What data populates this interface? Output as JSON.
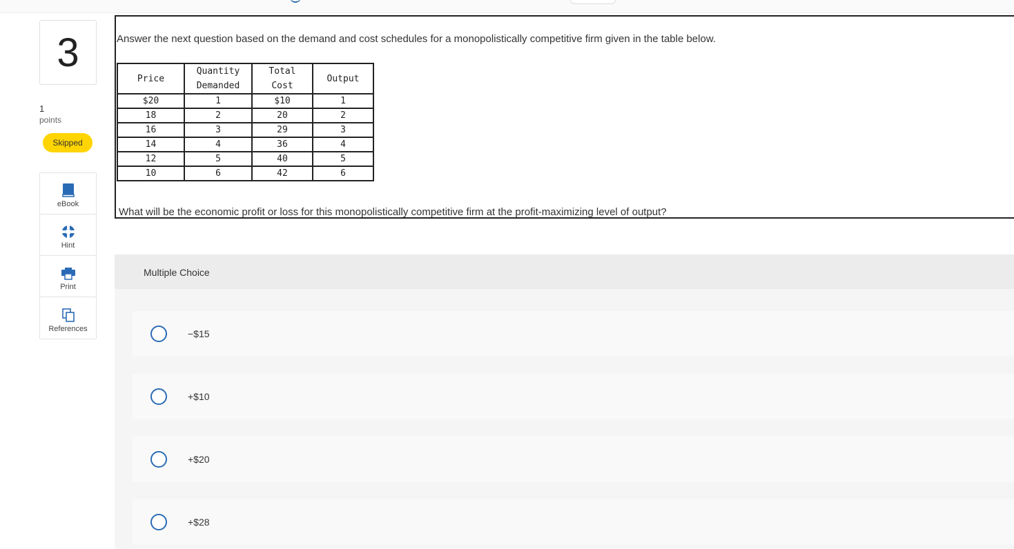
{
  "question": {
    "number": "3",
    "points_value": "1",
    "points_label": "points",
    "status_badge": "Skipped",
    "intro": "Answer the next question based on the demand and cost schedules for a monopolistically competitive firm given in the table below.",
    "prompt": "What will be the economic profit or loss for this monopolistically competitive firm at the profit-maximizing level of output?"
  },
  "tools": [
    {
      "label": "eBook",
      "icon": "book-icon"
    },
    {
      "label": "Hint",
      "icon": "lifebuoy-icon"
    },
    {
      "label": "Print",
      "icon": "printer-icon"
    },
    {
      "label": "References",
      "icon": "copy-icon"
    }
  ],
  "table": {
    "headers": [
      [
        "Price"
      ],
      [
        "Quantity",
        "Demanded"
      ],
      [
        "Total",
        "Cost"
      ],
      [
        "Output"
      ]
    ],
    "rows": [
      [
        "$20",
        "1",
        "$10",
        "1"
      ],
      [
        "18",
        "2",
        "20",
        "2"
      ],
      [
        "16",
        "3",
        "29",
        "3"
      ],
      [
        "14",
        "4",
        "36",
        "4"
      ],
      [
        "12",
        "5",
        "40",
        "5"
      ],
      [
        "10",
        "6",
        "42",
        "6"
      ]
    ]
  },
  "multiple_choice": {
    "title": "Multiple Choice",
    "options": [
      "−$15",
      "+$10",
      "+$20",
      "+$28"
    ]
  },
  "colors": {
    "badge": "#ffd400",
    "accent": "#2a6bb5"
  }
}
